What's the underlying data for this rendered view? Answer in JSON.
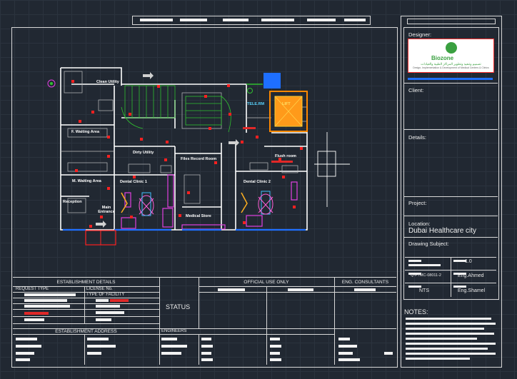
{
  "title_block_top": {
    "designer_label": "Designer:",
    "logo_text": "Biozone",
    "logo_subtitle": "تصميم وتنفيذ وتطوير المراكز الطبية والعيادات",
    "logo_subline": "Design, Implementation & Development of Medical Centers & Clinics",
    "client_label": "Client:",
    "details_label": "Details:",
    "project_label": "Project:",
    "location_label": "Location:",
    "location_value": "Dubai Healthcare city",
    "drawing_subject_label": "Drawing Subject:",
    "revision": "1.0",
    "drawing_no": "Q-FTMC-08011-2",
    "drawn_by": "Eng.Ahmed",
    "scale": "NTS",
    "checked_by": "Eng.Shamel",
    "notes_label": "NOTES:"
  },
  "bottom_table": {
    "establishment_details": "ESTABLISHMENT DETAILS",
    "request_type": "REQUEST TYPE",
    "license_no": "LICENSE No.",
    "type_of_facility": "TYPE OF FACILITY",
    "establishment_address": "ESTABLISHMENT ADDRESS",
    "engineers": "ENGINEERS",
    "status": "STATUS",
    "official_use_only": "OFFICIAL USE ONLY",
    "eng_consultants": "ENG. CONSULTANTS"
  },
  "plan": {
    "rooms": [
      "Clean Utility",
      "F. Waiting Area",
      "M. Waiting Area",
      "Reception",
      "Main Entrance",
      "Dirty Utility",
      "Files Record Room",
      "Dental Clinic 1",
      "Dental Clinic 2",
      "Medical Store",
      "Flush room",
      "TELE.RM",
      "LIFT"
    ],
    "colors": {
      "wall": "#ffffff",
      "tag_red": "#ff2020",
      "equipment_magenta": "#e040e0",
      "equipment_cyan": "#40c0ff",
      "lift_orange": "#ff8800",
      "stair_green": "#30c030",
      "blue_block": "#1e6fff"
    }
  }
}
